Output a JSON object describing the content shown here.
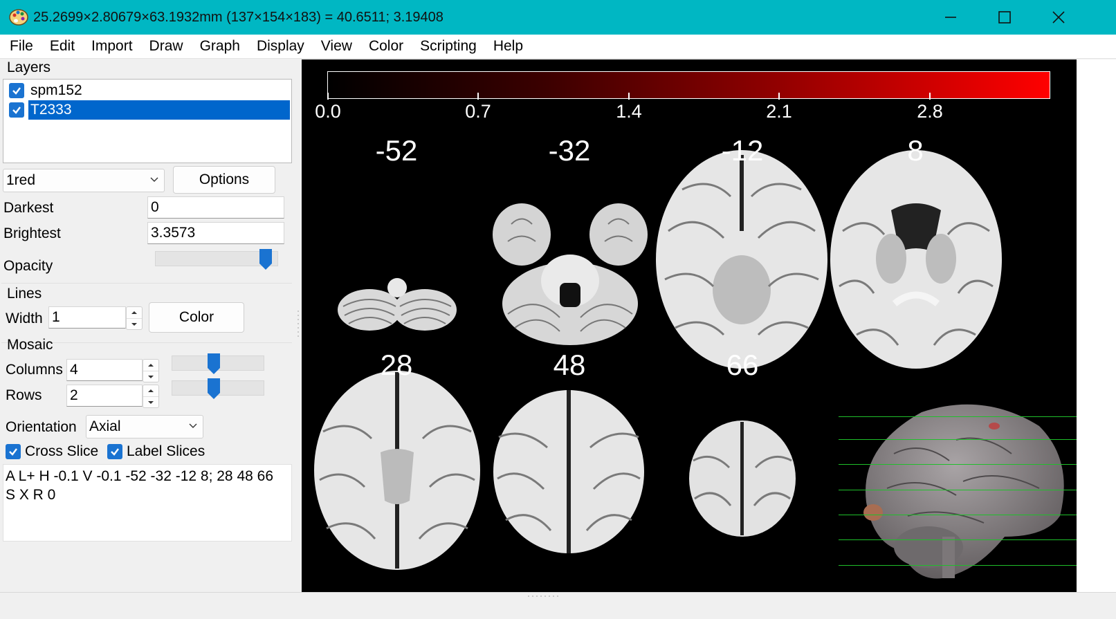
{
  "window": {
    "title": "25.2699×2.80679×63.1932mm (137×154×183) =  40.6511;  3.19408",
    "minimize_icon": "minimize-icon",
    "maximize_icon": "maximize-icon",
    "close_icon": "close-icon"
  },
  "menu": [
    "File",
    "Edit",
    "Import",
    "Draw",
    "Graph",
    "Display",
    "View",
    "Color",
    "Scripting",
    "Help"
  ],
  "layers": {
    "heading": "Layers",
    "items": [
      {
        "name": "spm152",
        "checked": true,
        "selected": false
      },
      {
        "name": "T2333",
        "checked": true,
        "selected": true
      }
    ],
    "colormap": "1red",
    "options_label": "Options",
    "darkest_label": "Darkest",
    "darkest_value": "0",
    "brightest_label": "Brightest",
    "brightest_value": "3.3573",
    "opacity_label": "Opacity",
    "opacity_value": 0.95
  },
  "lines": {
    "heading": "Lines",
    "width_label": "Width",
    "width_value": "1",
    "color_label": "Color"
  },
  "mosaic": {
    "heading": "Mosaic",
    "columns_label": "Columns",
    "columns_value": "4",
    "rows_label": "Rows",
    "rows_value": "2",
    "orientation_label": "Orientation",
    "orientation_value": "Axial",
    "cross_slice_label": "Cross Slice",
    "label_slices_label": "Label Slices",
    "script": "A L+ H -0.1 V -0.1 -52 -32 -12 8; 28 48 66\nS X R 0"
  },
  "viewer": {
    "colorbar_ticks": [
      "0.0",
      "0.7",
      "1.4",
      "2.1",
      "2.8"
    ],
    "colorbar_range": [
      0,
      3.3573
    ],
    "colorbar_colors": [
      "#000000",
      "#ff0000"
    ],
    "slices_row1": [
      "-52",
      "-32",
      "-12",
      "8"
    ],
    "slices_row2": [
      "28",
      "48",
      "66"
    ]
  }
}
